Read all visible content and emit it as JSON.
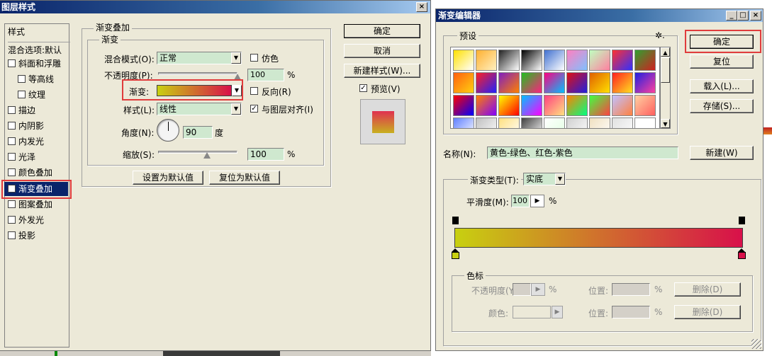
{
  "layer_style": {
    "title": "图层样式",
    "close": "×",
    "sidebar": {
      "styles_header": "样式",
      "blend_options": "混合选项:默认",
      "items": [
        {
          "label": "斜面和浮雕",
          "checked": false
        },
        {
          "label": "等高线",
          "checked": false
        },
        {
          "label": "纹理",
          "checked": false
        },
        {
          "label": "描边",
          "checked": false
        },
        {
          "label": "内阴影",
          "checked": false
        },
        {
          "label": "内发光",
          "checked": false
        },
        {
          "label": "光泽",
          "checked": false
        },
        {
          "label": "颜色叠加",
          "checked": false
        },
        {
          "label": "渐变叠加",
          "checked": true
        },
        {
          "label": "图案叠加",
          "checked": false
        },
        {
          "label": "外发光",
          "checked": false
        },
        {
          "label": "投影",
          "checked": false
        }
      ]
    },
    "panel": {
      "group_title": "渐变叠加",
      "sub_title": "渐变",
      "blend_mode_label": "混合模式(O):",
      "blend_mode_value": "正常",
      "dither_label": "仿色",
      "opacity_label": "不透明度(P):",
      "opacity_value": "100",
      "percent": "%",
      "gradient_label": "渐变:",
      "reverse_label": "反向(R)",
      "style_label": "样式(L):",
      "style_value": "线性",
      "align_label": "与图层对齐(I)",
      "angle_label": "角度(N):",
      "angle_value": "90",
      "degree": "度",
      "scale_label": "缩放(S):",
      "scale_value": "100",
      "set_default": "设置为默认值",
      "reset_default": "复位为默认值"
    },
    "buttons": {
      "ok": "确定",
      "cancel": "取消",
      "new_style": "新建样式(W)...",
      "preview": "预览(V)"
    }
  },
  "gradient_editor": {
    "title": "渐变编辑器",
    "title_buttons": [
      "_",
      "□",
      "×"
    ],
    "presets_label": "预设",
    "gear": "✲.",
    "buttons": {
      "ok": "确定",
      "reset": "复位",
      "load": "载入(L)...",
      "save": "存储(S)...",
      "new": "新建(W)"
    },
    "name_label": "名称(N):",
    "name_value": "黄色-绿色、红色-紫色",
    "type_label": "渐变类型(T):",
    "type_value": "实底",
    "smooth_label": "平滑度(M):",
    "smooth_value": "100",
    "percent": "%",
    "stops": {
      "group": "色标",
      "opacity_label": "不透明度(Y):",
      "position_label": "位置:",
      "color_label": "颜色:",
      "position_label2": "位置:",
      "delete_label": "删除(D)",
      "delete_label2": "删除(D)"
    }
  },
  "colors": {
    "gradient_start": "#c8d010",
    "gradient_end": "#d8104a",
    "highlight": "#e03c3c",
    "title_bar": "#0a246a",
    "field": "#cfe8cf"
  }
}
